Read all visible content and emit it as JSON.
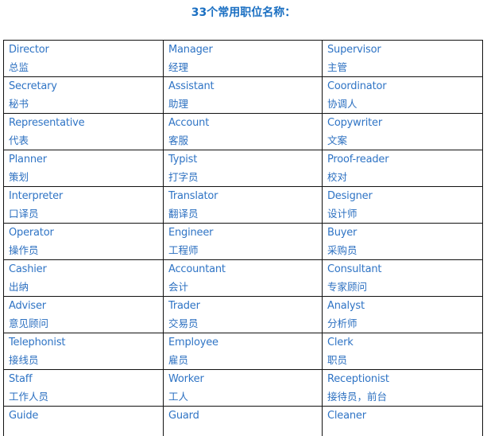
{
  "title": "33个常用职位名称：",
  "colors": {
    "title": "#1a6fc2",
    "text": "#2f74c5",
    "border": "#111111"
  },
  "rows": [
    [
      {
        "en": "Director",
        "zh": "总监"
      },
      {
        "en": "Manager",
        "zh": "经理"
      },
      {
        "en": "Supervisor",
        "zh": "主管"
      }
    ],
    [
      {
        "en": "Secretary",
        "zh": "秘书"
      },
      {
        "en": "Assistant",
        "zh": "助理"
      },
      {
        "en": "Coordinator",
        "zh": "协调人"
      }
    ],
    [
      {
        "en": "Representative",
        "zh": "代表"
      },
      {
        "en": "Account",
        "zh": "客服"
      },
      {
        "en": "Copywriter",
        "zh": "文案"
      }
    ],
    [
      {
        "en": "Planner",
        "zh": "策划"
      },
      {
        "en": "Typist",
        "zh": "打字员"
      },
      {
        "en": "Proof-reader",
        "zh": "校对"
      }
    ],
    [
      {
        "en": "Interpreter",
        "zh": "口译员"
      },
      {
        "en": "Translator",
        "zh": "翻译员"
      },
      {
        "en": "Designer",
        "zh": "设计师"
      }
    ],
    [
      {
        "en": "Operator",
        "zh": "操作员"
      },
      {
        "en": "Engineer",
        "zh": "工程师"
      },
      {
        "en": "Buyer",
        "zh": "采购员"
      }
    ],
    [
      {
        "en": "Cashier",
        "zh": "出纳"
      },
      {
        "en": "Accountant",
        "zh": "会计"
      },
      {
        "en": "Consultant",
        "zh": "专家顾问"
      }
    ],
    [
      {
        "en": "Adviser",
        "zh": "意见顾问"
      },
      {
        "en": "Trader",
        "zh": "交易员"
      },
      {
        "en": "Analyst",
        "zh": "分析师"
      }
    ],
    [
      {
        "en": "Telephonist",
        "zh": "接线员"
      },
      {
        "en": "Employee",
        "zh": "雇员"
      },
      {
        "en": "Clerk",
        "zh": "职员"
      }
    ],
    [
      {
        "en": "Staff",
        "zh": "工作人员"
      },
      {
        "en": "Worker",
        "zh": "工人"
      },
      {
        "en": "Receptionist",
        "zh": "接待员，前台"
      }
    ],
    [
      {
        "en": "Guide",
        "zh": ""
      },
      {
        "en": "Guard",
        "zh": ""
      },
      {
        "en": "Cleaner",
        "zh": ""
      }
    ]
  ]
}
